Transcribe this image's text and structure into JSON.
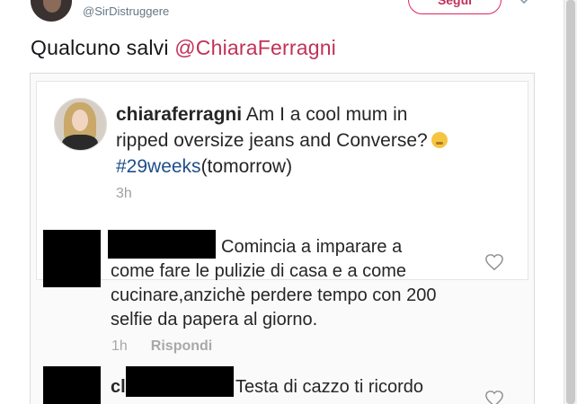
{
  "tweet": {
    "author_name": "",
    "handle": "@SirDistruggere",
    "follow_label": "Segui",
    "text_prefix": "Qualcuno salvi ",
    "mention": "@ChiaraFerragni"
  },
  "screenshot": {
    "post": {
      "username": "chiaraferragni",
      "caption_line1": " Am I a cool mum in",
      "caption_line2": "ripped oversize jeans and Converse?",
      "hashtag": "#29weeks",
      "caption_line3": "(tomorrow)",
      "time": "3h"
    },
    "comments": [
      {
        "text_line1": "Comincia a imparare a",
        "text_line2": "come fare le pulizie di casa e a come",
        "text_line3": "cucinare,anzichè perdere tempo con 200",
        "text_line4": "selfie da papera al giorno.",
        "time": "1h",
        "reply_label": "Rispondi"
      },
      {
        "username_partial": "cl",
        "text_line1": "Testa di cazzo ti ricordo"
      }
    ]
  },
  "colors": {
    "accent": "#e0245e",
    "handle": "#657786",
    "hashtag": "#1f4e89",
    "meta": "#a8a8a8"
  },
  "icons": [
    "caret-down-icon",
    "heart-icon",
    "thinking-face-emoji"
  ]
}
